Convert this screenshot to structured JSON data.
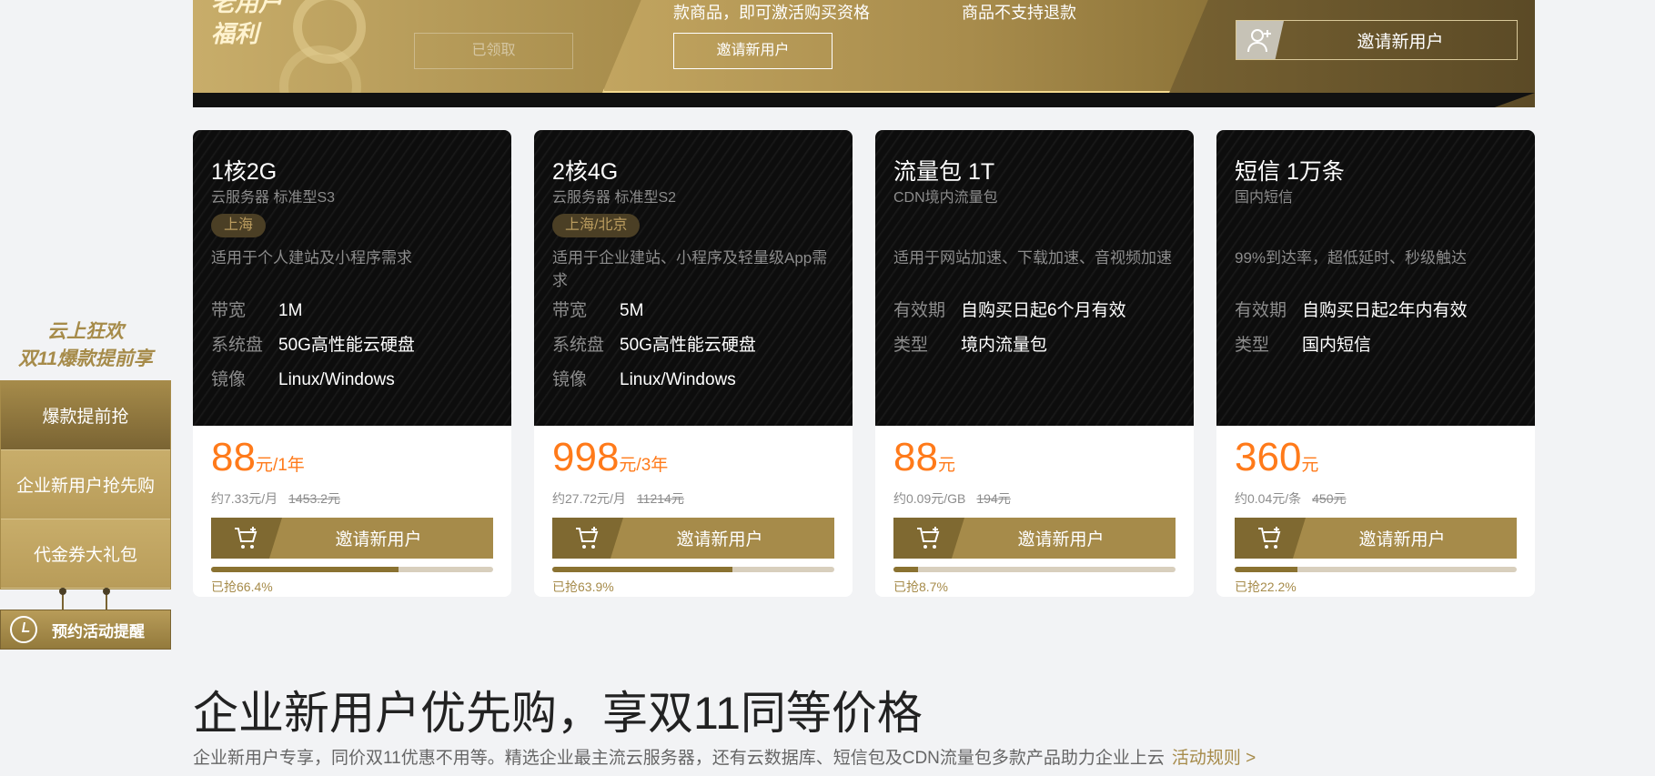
{
  "banner": {
    "title_line1": "老用户",
    "title_line2": "福利",
    "claimed_label": "已领取",
    "mid_text1": "款商品，即可激活购买资格",
    "mid_text2": "商品不支持退款",
    "mid_button": "邀请新用户",
    "invite_button": "邀请新用户"
  },
  "side_nav": {
    "heading_line1": "云上狂欢",
    "heading_line2": "双11爆款提前享",
    "items": [
      {
        "label": "爆款提前抢",
        "active": true
      },
      {
        "label": "企业新用户抢先购",
        "active": false
      },
      {
        "label": "代金券大礼包",
        "active": false
      }
    ],
    "remind_label": "预约活动提醒"
  },
  "cards": [
    {
      "title": "1核2G",
      "subtitle": "云服务器 标准型S3",
      "region": "上海",
      "desc": "适用于个人建站及小程序需求",
      "specs": [
        {
          "k": "带宽",
          "v": "1M"
        },
        {
          "k": "系统盘",
          "v": "50G高性能云硬盘"
        },
        {
          "k": "镜像",
          "v": "Linux/Windows"
        }
      ],
      "price": "88",
      "price_unit": "元/1年",
      "unit_price": "约7.33元/月",
      "orig_price": "1453.2元",
      "button": "邀请新用户",
      "progress": 0.664,
      "sold": "已抢66.4%"
    },
    {
      "title": "2核4G",
      "subtitle": "云服务器 标准型S2",
      "region": "上海/北京",
      "desc": "适用于企业建站、小程序及轻量级App需求",
      "specs": [
        {
          "k": "带宽",
          "v": "5M"
        },
        {
          "k": "系统盘",
          "v": "50G高性能云硬盘"
        },
        {
          "k": "镜像",
          "v": "Linux/Windows"
        }
      ],
      "price": "998",
      "price_unit": "元/3年",
      "unit_price": "约27.72元/月",
      "orig_price": "11214元",
      "button": "邀请新用户",
      "progress": 0.639,
      "sold": "已抢63.9%"
    },
    {
      "title": "流量包 1T",
      "subtitle": "CDN境内流量包",
      "region": "",
      "desc": "适用于网站加速、下载加速、音视频加速",
      "specs": [
        {
          "k": "有效期",
          "v": "自购买日起6个月有效"
        },
        {
          "k": "类型",
          "v": "境内流量包"
        }
      ],
      "price": "88",
      "price_unit": "元",
      "unit_price": "约0.09元/GB",
      "orig_price": "194元",
      "button": "邀请新用户",
      "progress": 0.087,
      "sold": "已抢8.7%"
    },
    {
      "title": "短信 1万条",
      "subtitle": "国内短信",
      "region": "",
      "desc": "99%到达率，超低延时、秒级触达",
      "specs": [
        {
          "k": "有效期",
          "v": "自购买日起2年内有效"
        },
        {
          "k": "类型",
          "v": "国内短信"
        }
      ],
      "price": "360",
      "price_unit": "元",
      "unit_price": "约0.04元/条",
      "orig_price": "450元",
      "button": "邀请新用户",
      "progress": 0.222,
      "sold": "已抢22.2%"
    }
  ],
  "section": {
    "title": "企业新用户优先购，享双11同等价格",
    "desc": "企业新用户专享，同价双11优惠不用等。精选企业最主流云服务器，还有云数据库、短信包及CDN流量包多款产品助力企业上云",
    "rules_link": "活动规则 >"
  }
}
